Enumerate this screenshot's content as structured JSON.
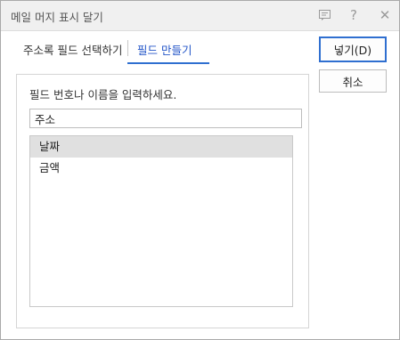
{
  "window": {
    "title": "메일 머지 표시 달기",
    "help_glyph": "?",
    "close_glyph": "✕"
  },
  "tabs": [
    {
      "label": "주소록 필드 선택하기",
      "active": false
    },
    {
      "label": "필드 만들기",
      "active": true
    }
  ],
  "form": {
    "prompt": "필드 번호나 이름을 입력하세요.",
    "field_value": "주소",
    "items": [
      {
        "label": "날짜",
        "selected": true
      },
      {
        "label": "금액",
        "selected": false
      }
    ]
  },
  "buttons": {
    "insert_label": "넣기(D)",
    "cancel_label": "취소"
  },
  "colors": {
    "accent": "#2f6fd0",
    "active_tab_text": "#2456c8",
    "selected_row": "#e0e0e0"
  }
}
